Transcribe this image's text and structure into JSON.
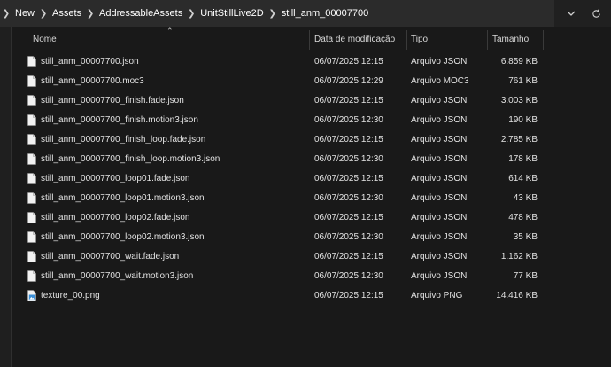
{
  "breadcrumb": {
    "items": [
      "New",
      "Assets",
      "AddressableAssets",
      "UnitStillLive2D",
      "still_anm_00007700"
    ]
  },
  "columns": {
    "name": "Nome",
    "date": "Data de modificação",
    "type": "Tipo",
    "size": "Tamanho"
  },
  "files": [
    {
      "name": "still_anm_00007700.json",
      "date": "06/07/2025 12:15",
      "type": "Arquivo JSON",
      "size": "6.859 KB",
      "icon": "document-icon"
    },
    {
      "name": "still_anm_00007700.moc3",
      "date": "06/07/2025 12:29",
      "type": "Arquivo MOC3",
      "size": "761 KB",
      "icon": "document-icon"
    },
    {
      "name": "still_anm_00007700_finish.fade.json",
      "date": "06/07/2025 12:15",
      "type": "Arquivo JSON",
      "size": "3.003 KB",
      "icon": "document-icon"
    },
    {
      "name": "still_anm_00007700_finish.motion3.json",
      "date": "06/07/2025 12:30",
      "type": "Arquivo JSON",
      "size": "190 KB",
      "icon": "document-icon"
    },
    {
      "name": "still_anm_00007700_finish_loop.fade.json",
      "date": "06/07/2025 12:15",
      "type": "Arquivo JSON",
      "size": "2.785 KB",
      "icon": "document-icon"
    },
    {
      "name": "still_anm_00007700_finish_loop.motion3.json",
      "date": "06/07/2025 12:30",
      "type": "Arquivo JSON",
      "size": "178 KB",
      "icon": "document-icon"
    },
    {
      "name": "still_anm_00007700_loop01.fade.json",
      "date": "06/07/2025 12:15",
      "type": "Arquivo JSON",
      "size": "614 KB",
      "icon": "document-icon"
    },
    {
      "name": "still_anm_00007700_loop01.motion3.json",
      "date": "06/07/2025 12:30",
      "type": "Arquivo JSON",
      "size": "43 KB",
      "icon": "document-icon"
    },
    {
      "name": "still_anm_00007700_loop02.fade.json",
      "date": "06/07/2025 12:15",
      "type": "Arquivo JSON",
      "size": "478 KB",
      "icon": "document-icon"
    },
    {
      "name": "still_anm_00007700_loop02.motion3.json",
      "date": "06/07/2025 12:30",
      "type": "Arquivo JSON",
      "size": "35 KB",
      "icon": "document-icon"
    },
    {
      "name": "still_anm_00007700_wait.fade.json",
      "date": "06/07/2025 12:15",
      "type": "Arquivo JSON",
      "size": "1.162 KB",
      "icon": "document-icon"
    },
    {
      "name": "still_anm_00007700_wait.motion3.json",
      "date": "06/07/2025 12:30",
      "type": "Arquivo JSON",
      "size": "77 KB",
      "icon": "document-icon"
    },
    {
      "name": "texture_00.png",
      "date": "06/07/2025 12:15",
      "type": "Arquivo PNG",
      "size": "14.416 KB",
      "icon": "image-file-icon"
    }
  ],
  "colors": {
    "background": "#191919",
    "addressbar": "#2b2b2b",
    "text": "#e2e2e2",
    "image_icon": "#3a8fd8"
  }
}
